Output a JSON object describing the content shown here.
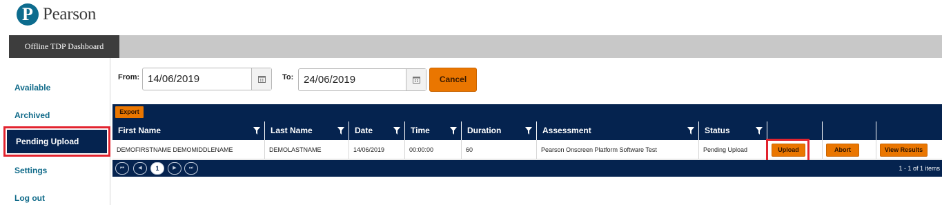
{
  "brand": {
    "logo_letter": "P",
    "name": "Pearson"
  },
  "topbar": {
    "tab_label": "Offline TDP Dashboard"
  },
  "sidebar": {
    "items": [
      {
        "label": "Available"
      },
      {
        "label": "Archived"
      },
      {
        "label": "Pending Upload",
        "active": true
      },
      {
        "label": "Settings"
      },
      {
        "label": "Log out"
      }
    ]
  },
  "filters": {
    "from_label": "From:",
    "from_value": "14/06/2019",
    "to_label": "To:",
    "to_value": "24/06/2019",
    "cancel_label": "Cancel"
  },
  "grid": {
    "export_label": "Export",
    "columns": [
      "First Name",
      "Last Name",
      "Date",
      "Time",
      "Duration",
      "Assessment",
      "Status"
    ],
    "rows": [
      {
        "first_name": "DEMOFIRSTNAME DEMOMIDDLENAME",
        "last_name": "DEMOLASTNAME",
        "date": "14/06/2019",
        "time": "00:00:00",
        "duration": "60",
        "assessment": "Pearson Onscreen Platform Software Test",
        "status": "Pending Upload",
        "actions": [
          "Upload",
          "Abort",
          "View Results"
        ]
      }
    ],
    "pager": {
      "first_icon": "first-page-icon",
      "prev_icon": "prev-page-icon",
      "current_page": "1",
      "next_icon": "next-page-icon",
      "last_icon": "last-page-icon",
      "info": "1 - 1 of 1 items"
    }
  },
  "colors": {
    "brand_teal": "#0d6c8e",
    "nav_blue": "#0f6a89",
    "navy": "#05234f",
    "accent_orange": "#ea7600",
    "highlight_red": "#e2232e"
  }
}
